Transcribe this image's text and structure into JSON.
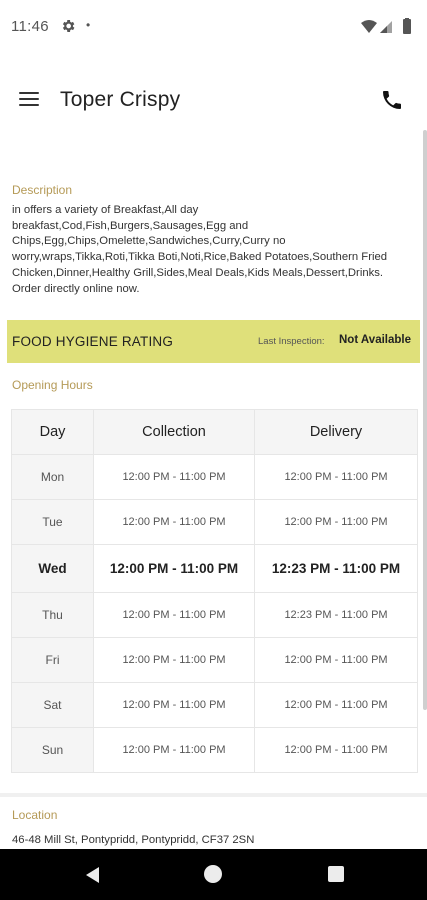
{
  "status_bar": {
    "time": "11:46",
    "dot": "•",
    "icons": [
      "gear-icon",
      "wifi-icon",
      "signal-icon",
      "battery-icon"
    ]
  },
  "app_bar": {
    "title": "Toper Crispy",
    "icons": [
      "menu-icon",
      "phone-icon"
    ]
  },
  "description": {
    "label": "Description",
    "text": "in offers a variety of Breakfast,All day breakfast,Cod,Fish,Burgers,Sausages,Egg and Chips,Egg,Chips,Omelette,Sandwiches,Curry,Curry no worry,wraps,Tikka,Roti,Tikka Boti,Noti,Rice,Baked Potatoes,Southern Fried Chicken,Dinner,Healthy Grill,Sides,Meal Deals,Kids Meals,Dessert,Drinks. Order directly online now."
  },
  "hygiene": {
    "title": "FOOD HYGIENE RATING",
    "inspection_label": "Last Inspection:",
    "inspection_value": "Not Available",
    "color": "#dfe07a"
  },
  "opening_hours": {
    "label": "Opening Hours",
    "headers": {
      "day": "Day",
      "collection": "Collection",
      "delivery": "Delivery"
    },
    "rows": [
      {
        "day": "Mon",
        "collection": "12:00 PM - 11:00 PM",
        "delivery": "12:00 PM - 11:00 PM",
        "today": false
      },
      {
        "day": "Tue",
        "collection": "12:00 PM - 11:00 PM",
        "delivery": "12:00 PM - 11:00 PM",
        "today": false
      },
      {
        "day": "Wed",
        "collection": "12:00 PM - 11:00 PM",
        "delivery": "12:23 PM - 11:00 PM",
        "today": true
      },
      {
        "day": "Thu",
        "collection": "12:00 PM - 11:00 PM",
        "delivery": "12:23 PM - 11:00 PM",
        "today": false
      },
      {
        "day": "Fri",
        "collection": "12:00 PM - 11:00 PM",
        "delivery": "12:00 PM - 11:00 PM",
        "today": false
      },
      {
        "day": "Sat",
        "collection": "12:00 PM - 11:00 PM",
        "delivery": "12:00 PM - 11:00 PM",
        "today": false
      },
      {
        "day": "Sun",
        "collection": "12:00 PM - 11:00 PM",
        "delivery": "12:00 PM - 11:00 PM",
        "today": false
      }
    ]
  },
  "location": {
    "label": "Location",
    "address": "46-48 Mill St, Pontypridd, Pontypridd, CF37 2SN"
  },
  "nav_bar": {
    "icons": [
      "back-icon",
      "home-icon",
      "recents-icon"
    ]
  }
}
